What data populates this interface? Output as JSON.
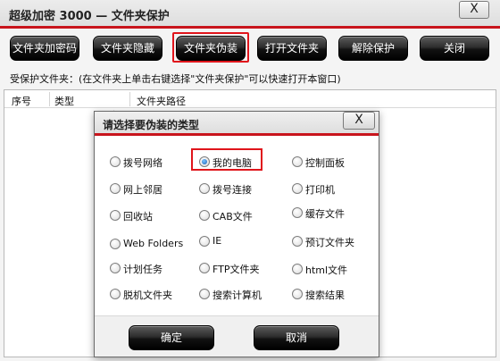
{
  "main_window": {
    "title": "超级加密 3000 — 文件夹保护",
    "close_label": "X",
    "toolbar": {
      "buttons": [
        "文件夹加密码",
        "文件夹隐藏",
        "文件夹伪装",
        "打开文件夹",
        "解除保护",
        "关闭"
      ]
    },
    "hint": "受保护文件夹：(在文件夹上单击右键选择\"文件夹保护\"可以快速打开本窗口)",
    "list": {
      "columns": [
        "序号",
        "类型",
        "文件夹路径"
      ]
    }
  },
  "dialog": {
    "title": "请选择要伪装的类型",
    "close_label": "X",
    "options": [
      "拨号网络",
      "我的电脑",
      "控制面板",
      "网上邻居",
      "拨号连接",
      "打印机",
      "回收站",
      "CAB文件",
      "缓存文件",
      "Web Folders",
      "IE",
      "预订文件夹",
      "计划任务",
      "FTP文件夹",
      "html文件",
      "脱机文件夹",
      "搜索计算机",
      "搜索结果"
    ],
    "selected_option": "我的电脑",
    "ok_label": "确定",
    "cancel_label": "取消"
  },
  "colors": {
    "accent": "#c8141c",
    "highlight_frame": "#e0151b",
    "button_dark": "#000000"
  }
}
